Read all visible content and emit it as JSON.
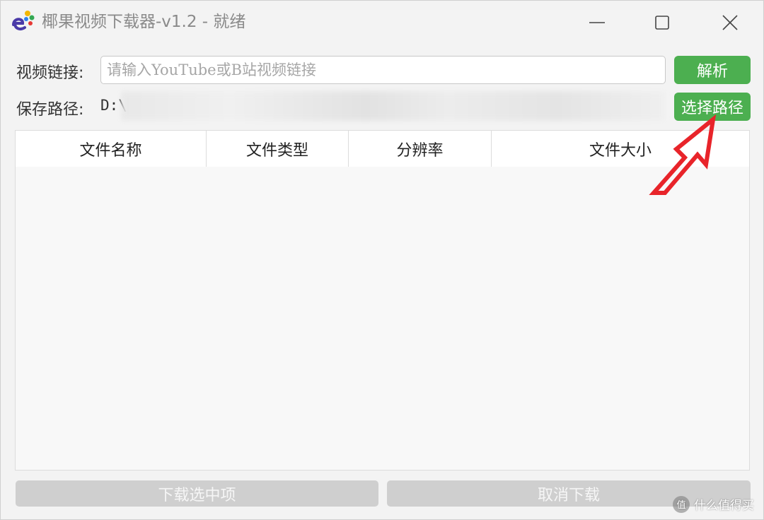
{
  "window": {
    "title": "椰果视频下载器-v1.2 - 就绪"
  },
  "form": {
    "url_label": "视频链接:",
    "url_placeholder": "请输入YouTube或B站视频链接",
    "url_value": "",
    "parse_button": "解析",
    "path_label": "保存路径:",
    "path_value": "D:\\",
    "choose_path_button": "选择路径"
  },
  "table": {
    "columns": [
      "文件名称",
      "文件类型",
      "分辨率",
      "文件大小"
    ],
    "rows": []
  },
  "actions": {
    "download_selected": "下载选中项",
    "cancel_download": "取消下载"
  },
  "watermark": {
    "icon_text": "值",
    "text": "什么值得买"
  },
  "colors": {
    "accent_green": "#4caf50",
    "disabled_gray": "#cfcfcf",
    "annotation_red": "#e8242a"
  }
}
